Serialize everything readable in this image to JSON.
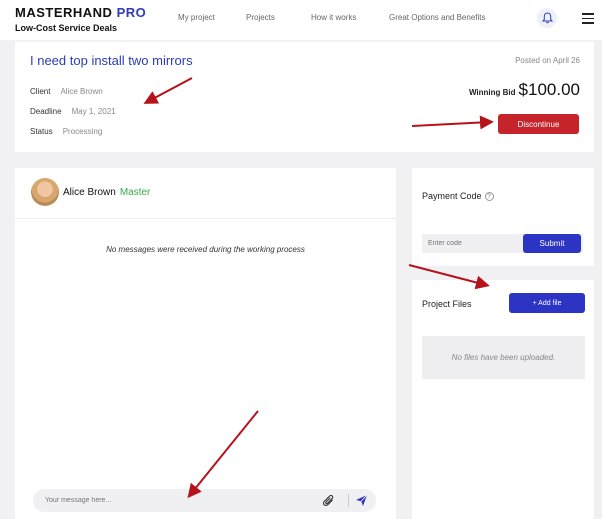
{
  "header": {
    "brand_main": "MASTERHAND",
    "brand_accent": "PRO",
    "tagline": "Low-Cost Service Deals",
    "nav": [
      "My project",
      "Projects",
      "How it works",
      "Great Options and Benefits"
    ],
    "accent_color": "#2e3bb8"
  },
  "project": {
    "title": "I need top install two mirrors",
    "posted": "Posted on April 26",
    "client_label": "Client",
    "client_value": "Alice Brown",
    "deadline_label": "Deadline",
    "deadline_value": "May 1, 2021",
    "status_label": "Status",
    "status_value": "Processing",
    "winning_bid_label": "Winning Bid",
    "winning_bid_value": "$100.00",
    "discontinue_label": "Discontinue"
  },
  "chat": {
    "user_name": "Alice Brown",
    "user_badge": "Master",
    "empty_text": "No messages were received during the working process",
    "input_placeholder": "Your message here..."
  },
  "payment": {
    "title": "Payment Code",
    "input_placeholder": "Enter code",
    "submit_label": "Submit"
  },
  "files": {
    "title": "Project Files",
    "add_label": "+ Add file",
    "empty_text": "No files have been uploaded."
  },
  "icons": [
    "bell-icon",
    "menu-icon",
    "info-icon",
    "paperclip-icon",
    "send-icon"
  ]
}
